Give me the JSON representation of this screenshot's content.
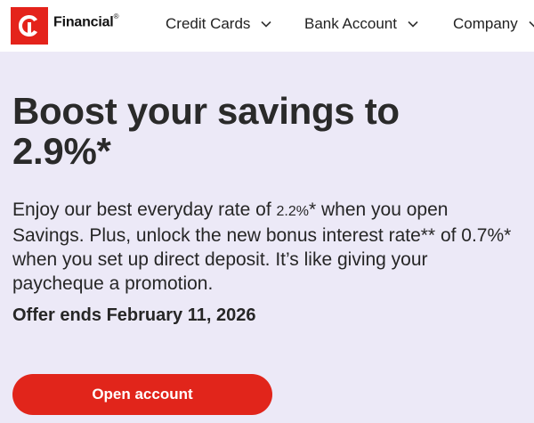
{
  "header": {
    "brand": "Financial",
    "brand_mark": "®",
    "logo_icon": "pc-logo-icon",
    "nav": [
      {
        "label": "Credit Cards",
        "icon": "chevron-down-icon"
      },
      {
        "label": "Bank Account",
        "icon": "chevron-down-icon"
      },
      {
        "label": "Company",
        "icon": "chevron-down-icon"
      }
    ]
  },
  "hero": {
    "title_line1": "Boost your savings to",
    "title_line2": "2.9%*",
    "body_before": "Enjoy our best everyday rate of ",
    "body_rate": "2.2%",
    "body_after": "* when you open Savings. Plus, unlock the new bonus interest rate** of 0.7%* when you set up direct deposit. It’s like giving your paycheque a promotion.",
    "offer": "Offer ends February 11, 2026",
    "cta": "Open account"
  },
  "colors": {
    "brand_red": "#e1251b",
    "hero_bg": "#ece9f7",
    "header_bg": "#ffffff"
  }
}
